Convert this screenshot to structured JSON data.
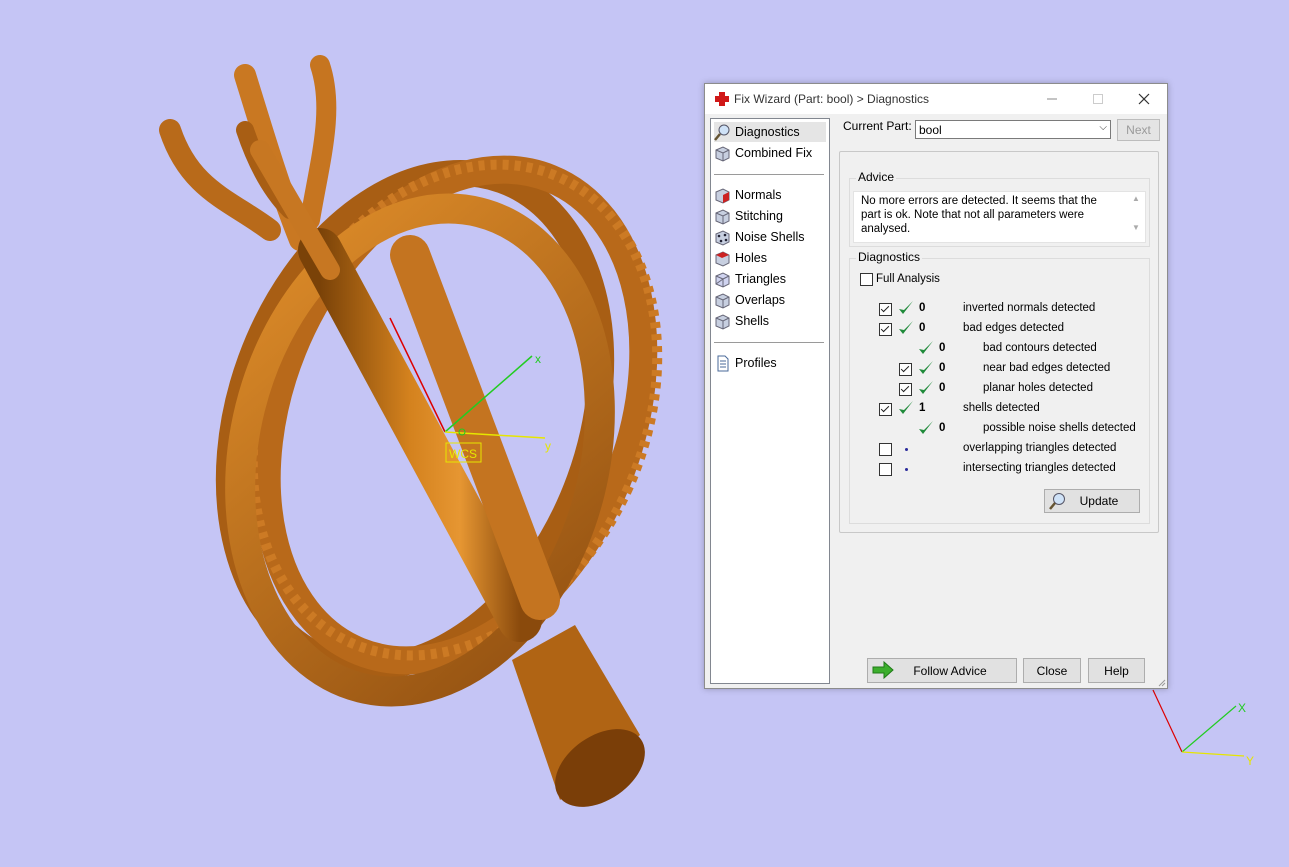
{
  "viewport": {
    "background": "#c5c5f5",
    "wcs_label": "WCS",
    "axis_x_label": "x",
    "axis_y_label": "y",
    "corner_axis_x_label": "X",
    "corner_axis_y_label": "Y",
    "model_color": "#c87520",
    "model": "3D ring part in orange-bronze with spiked beaded bands and support sprue"
  },
  "dialog": {
    "title": "Fix Wizard (Part: bool) > Diagnostics",
    "title_icon": "red-cross-icon",
    "window_buttons": [
      "minimize",
      "maximize",
      "close"
    ],
    "nav": {
      "top": [
        {
          "label": "Diagnostics",
          "icon": "magnifier-icon",
          "selected": true
        },
        {
          "label": "Combined Fix",
          "icon": "cube-icon"
        }
      ],
      "tools": [
        {
          "label": "Normals",
          "icon": "normals-cube-icon"
        },
        {
          "label": "Stitching",
          "icon": "stitching-cube-icon"
        },
        {
          "label": "Noise Shells",
          "icon": "noise-shells-cube-icon"
        },
        {
          "label": "Holes",
          "icon": "holes-cube-icon"
        },
        {
          "label": "Triangles",
          "icon": "triangles-cube-icon"
        },
        {
          "label": "Overlaps",
          "icon": "overlaps-cube-icon"
        },
        {
          "label": "Shells",
          "icon": "shells-cube-icon"
        }
      ],
      "bottom": [
        {
          "label": "Profiles",
          "icon": "document-icon"
        }
      ]
    },
    "current_part_label": "Current Part:",
    "current_part_value": "bool",
    "next_label": "Next",
    "advice": {
      "title": "Advice",
      "text": "No more errors are detected. It seems that the part is ok. Note that not all parameters were analysed."
    },
    "diagnostics": {
      "title": "Diagnostics",
      "full_analysis_label": "Full Analysis",
      "full_analysis_checked": false,
      "rows": [
        {
          "checkbox": true,
          "checked": true,
          "status": "ok",
          "value": "0",
          "label": "inverted normals detected",
          "indent": 0
        },
        {
          "checkbox": true,
          "checked": true,
          "status": "ok",
          "value": "0",
          "label": "bad edges detected",
          "indent": 0
        },
        {
          "checkbox": false,
          "checked": false,
          "status": "ok",
          "value": "0",
          "label": "bad contours detected",
          "indent": 1
        },
        {
          "checkbox": true,
          "checked": true,
          "status": "ok",
          "value": "0",
          "label": "near bad edges detected",
          "indent": 1
        },
        {
          "checkbox": true,
          "checked": true,
          "status": "ok",
          "value": "0",
          "label": "planar holes detected",
          "indent": 1
        },
        {
          "checkbox": true,
          "checked": true,
          "status": "ok",
          "value": "1",
          "label": "shells detected",
          "indent": 0
        },
        {
          "checkbox": false,
          "checked": false,
          "status": "ok",
          "value": "0",
          "label": "possible noise shells detected",
          "indent": 1
        },
        {
          "checkbox": true,
          "checked": false,
          "status": "none",
          "value": "",
          "label": "overlapping triangles detected",
          "indent": 0
        },
        {
          "checkbox": true,
          "checked": false,
          "status": "none",
          "value": "",
          "label": "intersecting triangles detected",
          "indent": 0
        }
      ],
      "update_label": "Update"
    },
    "footer": {
      "follow_advice_label": "Follow Advice",
      "close_label": "Close",
      "help_label": "Help"
    }
  }
}
